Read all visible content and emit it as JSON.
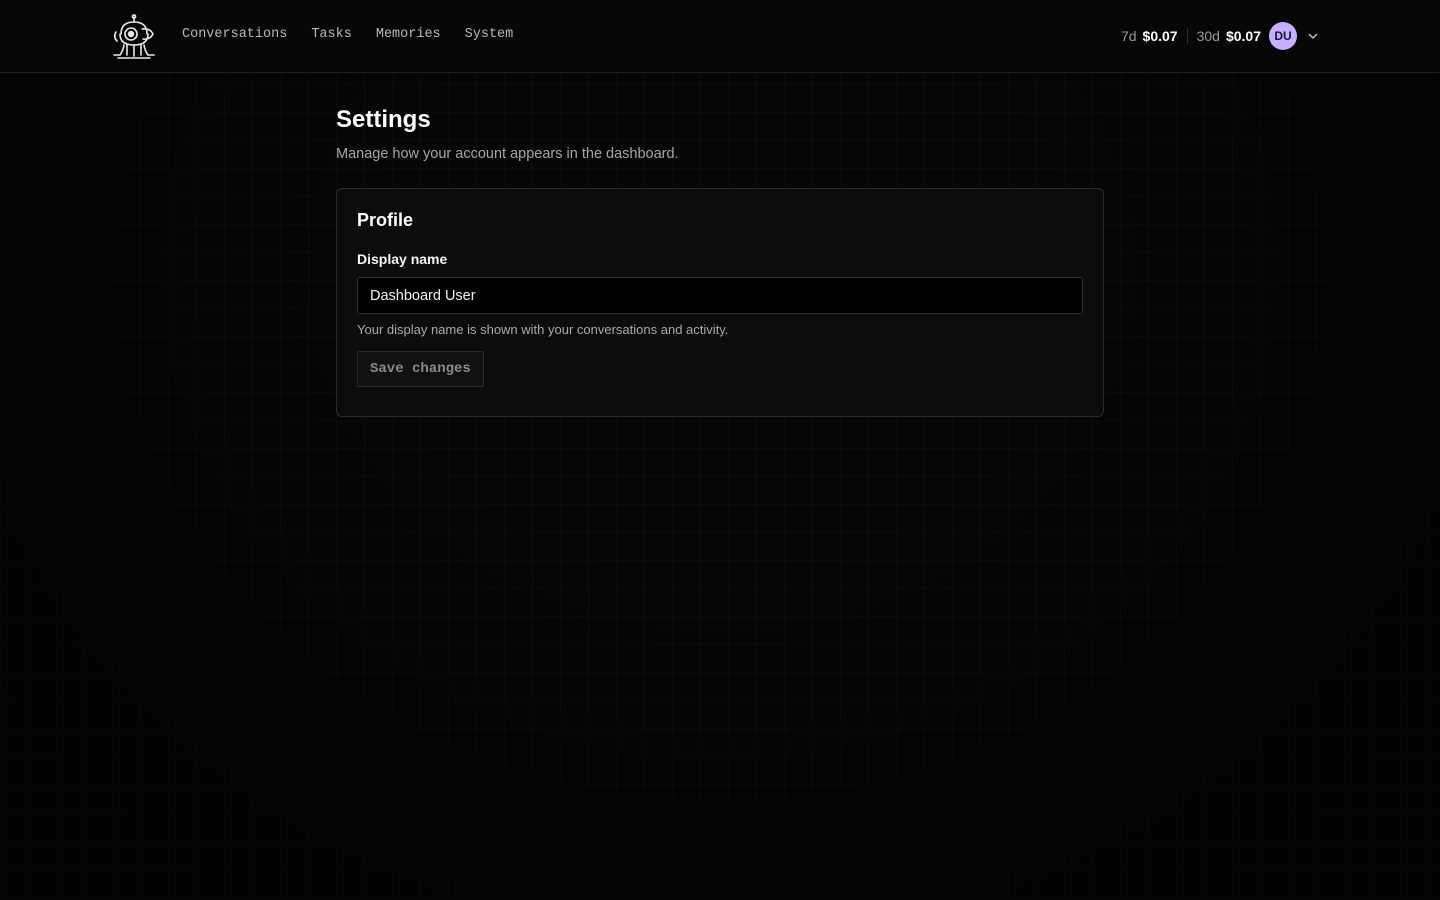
{
  "header": {
    "logo_icon": "robot-mascot-icon",
    "nav": [
      {
        "label": "Conversations"
      },
      {
        "label": "Tasks"
      },
      {
        "label": "Memories"
      },
      {
        "label": "System"
      }
    ],
    "usage": [
      {
        "period": "7d",
        "amount": "$0.07"
      },
      {
        "period": "30d",
        "amount": "$0.07"
      }
    ],
    "avatar": {
      "initials": "DU",
      "color": "#c3b0ff"
    },
    "menu_icon": "chevron-down-icon"
  },
  "main": {
    "title": "Settings",
    "subtitle": "Manage how your account appears in the dashboard.",
    "profile_card": {
      "title": "Profile",
      "display_name_label": "Display name",
      "display_name_value": "Dashboard User",
      "help_text": "Your display name is shown with your conversations and activity.",
      "save_label": "Save changes"
    }
  }
}
